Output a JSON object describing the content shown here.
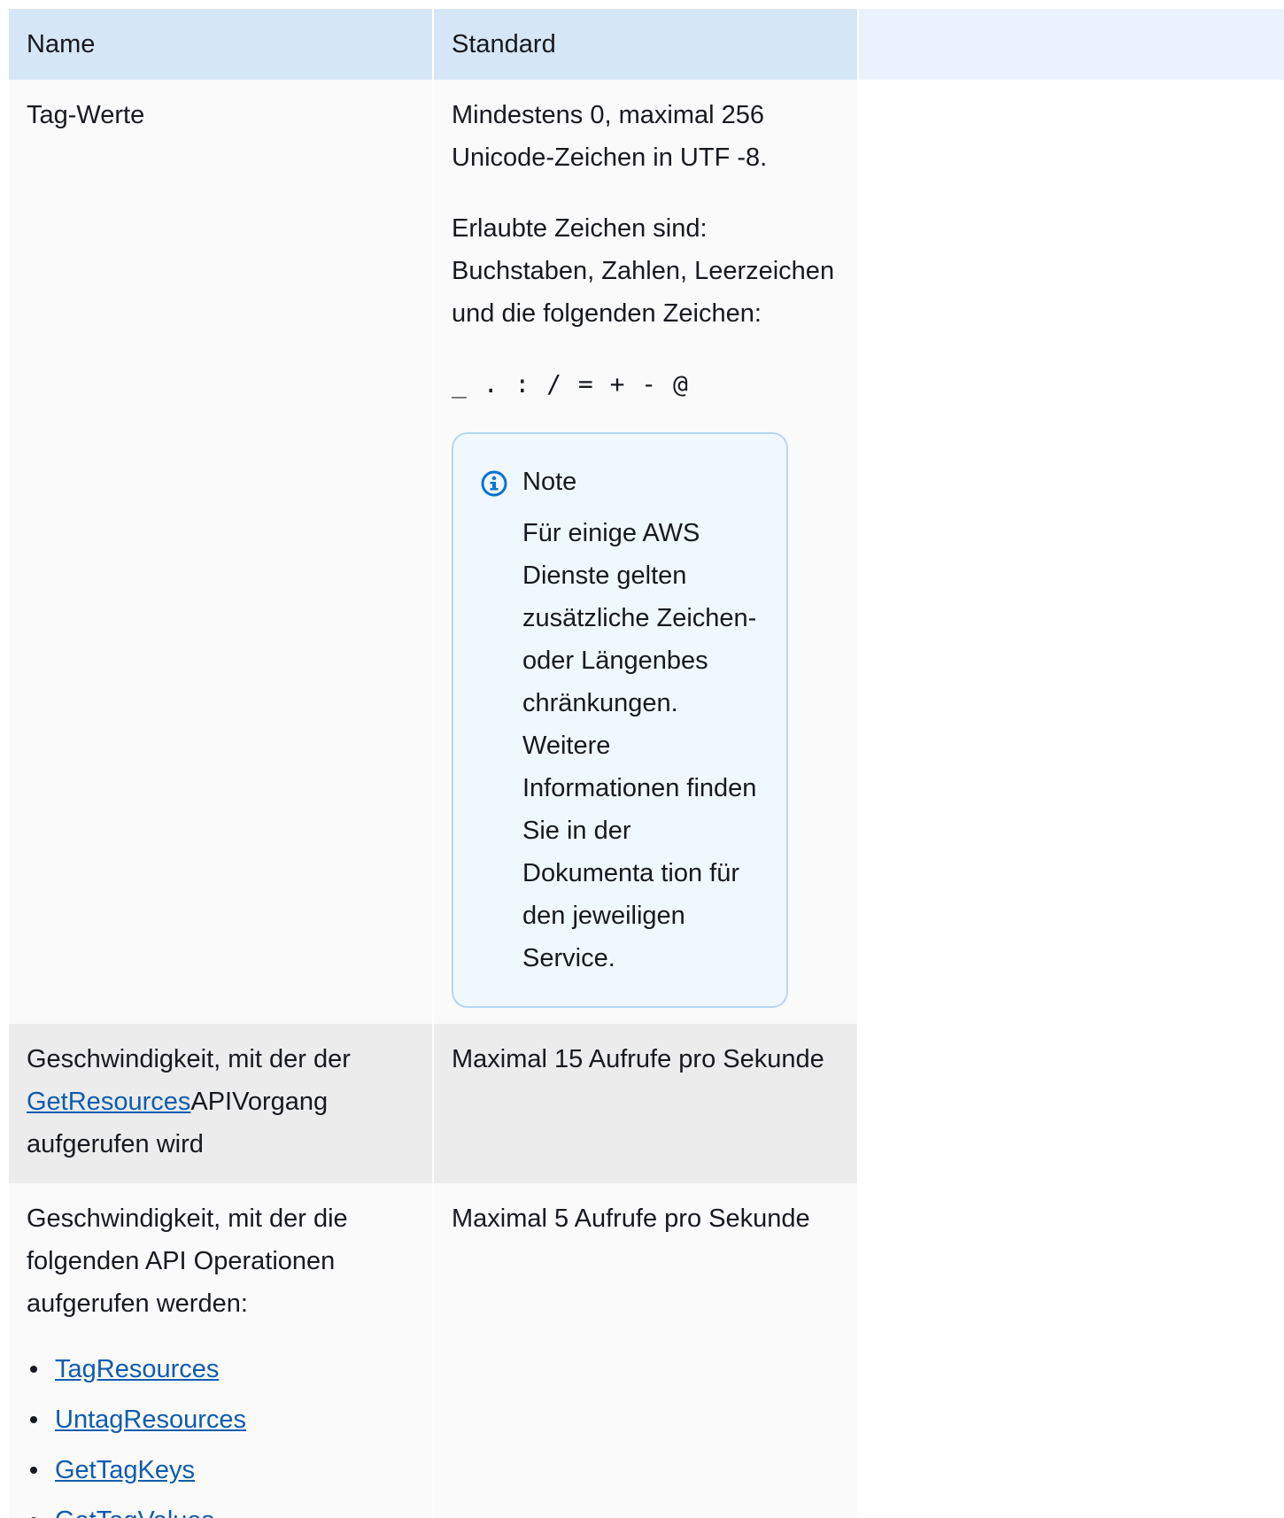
{
  "table": {
    "headers": [
      "Name",
      "Standard"
    ],
    "rows": {
      "tag_values": {
        "name": "Tag-Werte",
        "standard_p1": "Mindestens 0, maximal 256 Unicode-Zeichen in UTF -8.",
        "standard_p2": "Erlaubte Zeichen sind: Buchstaben, Zahlen, Leerzeichen und die folgenden Zeichen:",
        "allowed_chars": "_ . : / = + - @",
        "note": {
          "icon": "info-icon",
          "title": "Note",
          "text": "Für einige AWS Dienste gelten zusätzliche Zeichen- oder Längenbes chränkungen. Weitere Informationen finden Sie in der Dokumenta tion für den jeweiligen Service."
        }
      },
      "get_resources_rate": {
        "name_prefix": "Geschwindigkeit, mit der der ",
        "link": "GetResources",
        "name_suffix": "APIVorgang aufgerufen wird",
        "standard": "Maximal 15 Aufrufe pro Sekunde"
      },
      "ops_rate": {
        "name": "Geschwindigkeit, mit der die folgenden API Operationen aufgerufen werden:",
        "operations": [
          "TagResources",
          "UntagResources",
          "GetTagKeys",
          "GetTagValues"
        ],
        "standard": "Maximal 5 Aufrufe pro Sekunde"
      }
    }
  },
  "colors": {
    "header_bg": "#d5e7f7",
    "header_empty_bg": "#eaf3fd",
    "row_light": "#fafafa",
    "row_grey": "#ececec",
    "link": "#0f5cad",
    "note_border": "#b5d5f2",
    "note_bg": "#f0f8ff",
    "info_icon": "#0972d3"
  }
}
